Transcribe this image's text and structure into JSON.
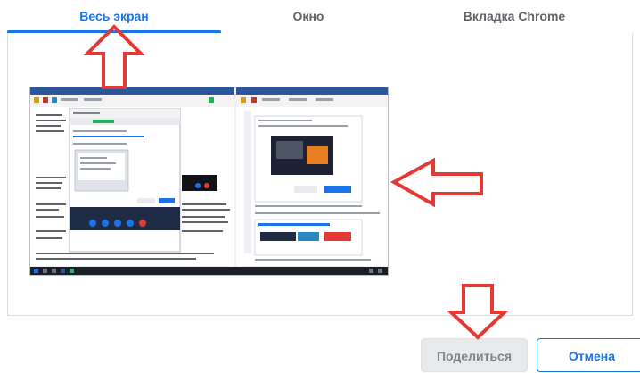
{
  "tabs": [
    {
      "label": "Весь экран",
      "active": true
    },
    {
      "label": "Окно",
      "active": false
    },
    {
      "label": "Вкладка Chrome",
      "active": false
    }
  ],
  "buttons": {
    "share_label": "Поделиться",
    "cancel_label": "Отмена"
  },
  "colors": {
    "accent": "#1a73e8",
    "annotation_arrow": "#e53935"
  }
}
